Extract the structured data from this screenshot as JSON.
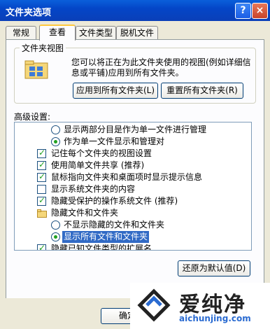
{
  "window": {
    "title": "文件夹选项",
    "help_icon": "?",
    "close_icon": "×"
  },
  "tabs": [
    {
      "label": "常规"
    },
    {
      "label": "查看",
      "active": true
    },
    {
      "label": "文件类型"
    },
    {
      "label": "脱机文件"
    }
  ],
  "folder_view": {
    "group_title": "文件夹视图",
    "description": "您可以将正在为此文件夹使用的视图(例如详细信息或平铺)应用到所有文件夹。",
    "apply_button": "应用到所有文件夹(L)",
    "reset_button": "重置所有文件夹(R)"
  },
  "advanced": {
    "label": "高级设置:",
    "items": [
      {
        "type": "radio",
        "label": "显示两部分目是作为单一文件进行管理",
        "checked": false
      },
      {
        "type": "radio",
        "label": "作为单一文件显示和管理对",
        "checked": true
      },
      {
        "type": "checkbox",
        "label": "记住每个文件夹的视图设置",
        "checked": true
      },
      {
        "type": "checkbox",
        "label": "使用简单文件共享 (推荐)",
        "checked": true
      },
      {
        "type": "checkbox",
        "label": "鼠标指向文件夹和桌面项时显示提示信息",
        "checked": true
      },
      {
        "type": "checkbox",
        "label": "显示系统文件夹的内容",
        "checked": false
      },
      {
        "type": "checkbox",
        "label": "隐藏受保护的操作系统文件 (推荐)",
        "checked": true
      },
      {
        "type": "folder",
        "label": "隐藏文件和文件夹"
      },
      {
        "type": "radio",
        "label": "不显示隐藏的文件和文件夹",
        "checked": false
      },
      {
        "type": "radio",
        "label": "显示所有文件和文件夹",
        "checked": true,
        "selected": true
      },
      {
        "type": "checkbox",
        "label": "隐藏已知文件类型的扩展名",
        "checked": true
      }
    ],
    "restore_button": "还原为默认值(D)"
  },
  "footer": {
    "ok_button": "确定"
  },
  "watermark": {
    "text": "爱纯净",
    "url": "aichunjing.com"
  },
  "colors": {
    "title_bar": "#0a5fdb",
    "selection": "#316ac5",
    "check": "#21a121"
  }
}
